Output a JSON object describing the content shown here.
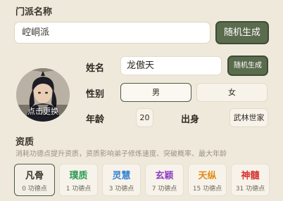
{
  "sect": {
    "title": "门派名称",
    "name_value": "崆峒派",
    "random_label": "随机生成"
  },
  "character": {
    "avatar_caption": "点击更换",
    "name_label": "姓名",
    "name_value": "龙傲天",
    "random_label": "随机生成",
    "gender_label": "性别",
    "gender_options": [
      "男",
      "女"
    ],
    "age_label": "年龄",
    "age_value": "20",
    "origin_label": "出身",
    "origin_value": "武林世家"
  },
  "aptitude": {
    "title": "资质",
    "description": "消耗功德点提升资质，资质影响弟子修炼速度、突破概率、最大年龄",
    "options": [
      {
        "name": "凡骨",
        "cost": "0 功德点",
        "color": "#3a342b"
      },
      {
        "name": "璞质",
        "cost": "1 功德点",
        "color": "#2e9a56"
      },
      {
        "name": "灵慧",
        "cost": "3 功德点",
        "color": "#2f7fd2"
      },
      {
        "name": "玄颖",
        "cost": "7 功德点",
        "color": "#8e3fc2"
      },
      {
        "name": "天纵",
        "cost": "15 功德点",
        "color": "#e08a12"
      },
      {
        "name": "神髓",
        "cost": "31 功德点",
        "color": "#d6332e"
      }
    ]
  },
  "colors": {
    "background": "#efe9dc",
    "accent_button": "#5a6c4d"
  }
}
